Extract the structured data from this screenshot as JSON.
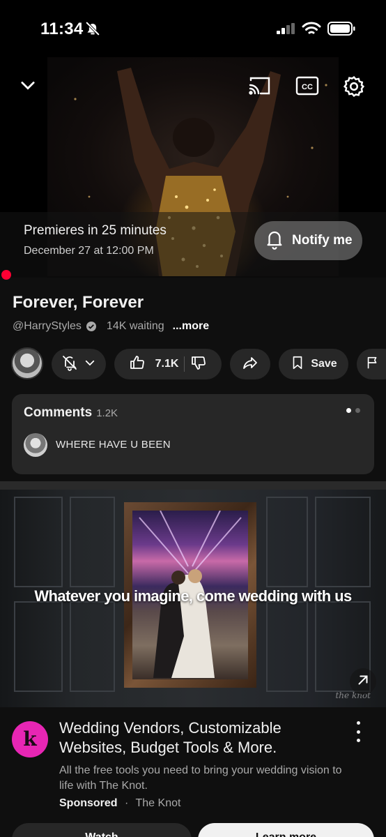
{
  "status_bar": {
    "time": "11:34",
    "icons": [
      "bell-off-icon",
      "cellular-signal-icon",
      "wifi-icon",
      "battery-icon"
    ]
  },
  "player": {
    "controls": [
      "chevron-down-icon",
      "cast-icon",
      "captions-icon",
      "settings-gear-icon"
    ],
    "premiere_text": "Premieres in 25 minutes",
    "premiere_date": "December 27 at 12:00 PM",
    "notify_label": "Notify me"
  },
  "video": {
    "title": "Forever, Forever",
    "channel": "@HarryStyles",
    "waiting": "14K waiting",
    "more": "...more"
  },
  "actions": {
    "likes": "7.1K",
    "save_label": "Save"
  },
  "comments": {
    "title": "Comments",
    "count": "1.2K",
    "top_comment": "WHERE HAVE U BEEN"
  },
  "ad": {
    "headline": "Whatever you imagine, come wedding with us",
    "watermark": "the knot",
    "title": "Wedding Vendors, Customizable Websites, Budget Tools & More.",
    "description": "All the free tools you need to bring your wedding vision to life with The Knot.",
    "sponsored_label": "Sponsored",
    "separator": "·",
    "advertiser": "The Knot",
    "logo_letter": "k",
    "left_button": "Watch",
    "right_button": "Learn more"
  },
  "colors": {
    "background": "#0f0f0f",
    "pill": "#272727",
    "live_red": "#ff0033",
    "knot_pink": "#e726b4"
  }
}
